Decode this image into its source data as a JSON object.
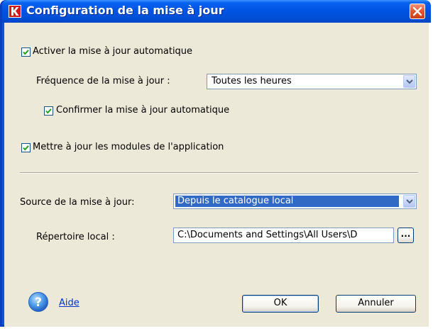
{
  "window": {
    "title": "Configuration de la mise à jour"
  },
  "options": {
    "auto_update_label": "Activer la mise à jour automatique",
    "auto_update_checked": true,
    "frequency_label": "Fréquence de la mise à jour :",
    "frequency_value": "Toutes les heures",
    "confirm_label": "Confirmer la mise à jour automatique",
    "confirm_checked": true,
    "modules_label": "Mettre à jour les modules de l'application",
    "modules_checked": true
  },
  "source": {
    "label": "Source de la mise à jour:",
    "value": "Depuis le catalogue local",
    "dir_label": "Répertoire local :",
    "dir_value": "C:\\Documents and Settings\\All Users\\D",
    "browse_label": "..."
  },
  "footer": {
    "help_label": "Aide",
    "ok_label": "OK",
    "cancel_label": "Annuler"
  },
  "colors": {
    "titlebar": "#0054e3",
    "dialog_background": "#ece9d8",
    "selection": "#316ac5",
    "link": "#0033cc"
  },
  "icons": [
    "kaspersky-logo-icon",
    "close-icon",
    "checkmark-icon",
    "chevron-down-icon",
    "help-icon"
  ]
}
